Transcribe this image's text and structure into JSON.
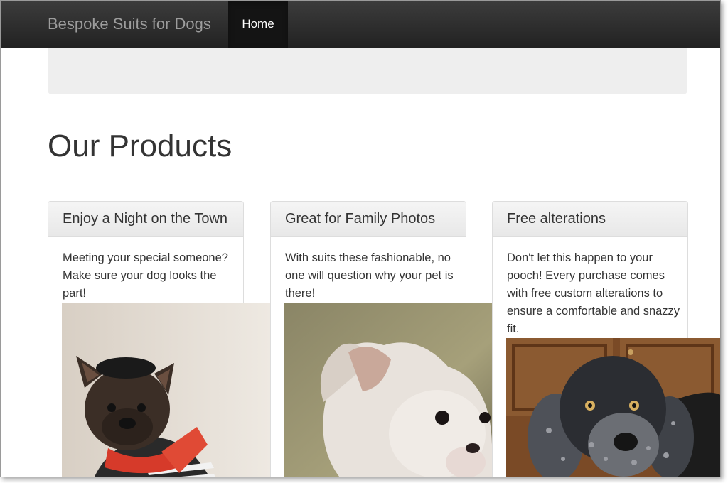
{
  "navbar": {
    "brand": "Bespoke Suits for Dogs",
    "home_label": "Home"
  },
  "page": {
    "title": "Our Products"
  },
  "products": [
    {
      "heading": "Enjoy a Night on the Town",
      "text": "Meeting your special someone? Make sure your dog looks the part!",
      "image": "french-bulldog-in-beret-and-striped-sweater"
    },
    {
      "heading": "Great for Family Photos",
      "text": "With suits these fashionable, no one will question why your pet is there!",
      "image": "chinese-crested-dog-closeup"
    },
    {
      "heading": "Free alterations",
      "text": "Don't let this happen to your pooch! Every purchase comes with free custom alterations to ensure a comfortable and snazzy fit.",
      "image": "spaniel-dog-closeup"
    }
  ],
  "colors": {
    "navbar_bg": "#222222",
    "brand_text": "#9d9d9d",
    "jumbotron_bg": "#eeeeee"
  }
}
